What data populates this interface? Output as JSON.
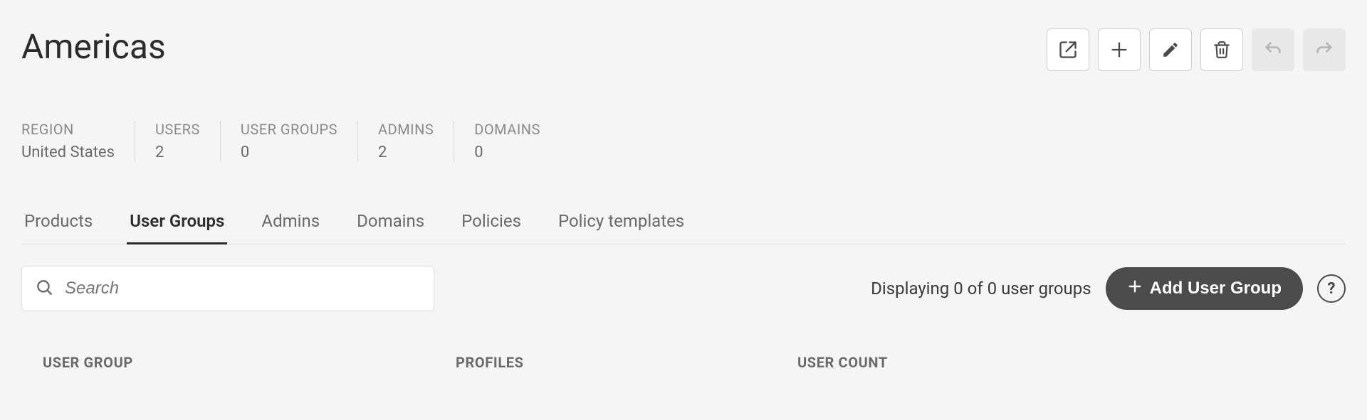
{
  "header": {
    "title": "Americas"
  },
  "toolbar": {
    "export_label": "Export",
    "add_label": "Add",
    "edit_label": "Edit",
    "delete_label": "Delete",
    "undo_label": "Undo",
    "redo_label": "Redo"
  },
  "stats": [
    {
      "label": "REGION",
      "value": "United States"
    },
    {
      "label": "USERS",
      "value": "2"
    },
    {
      "label": "USER GROUPS",
      "value": "0"
    },
    {
      "label": "ADMINS",
      "value": "2"
    },
    {
      "label": "DOMAINS",
      "value": "0"
    }
  ],
  "tabs": [
    {
      "label": "Products",
      "active": false
    },
    {
      "label": "User Groups",
      "active": true
    },
    {
      "label": "Admins",
      "active": false
    },
    {
      "label": "Domains",
      "active": false
    },
    {
      "label": "Policies",
      "active": false
    },
    {
      "label": "Policy templates",
      "active": false
    }
  ],
  "search": {
    "placeholder": "Search",
    "value": ""
  },
  "result_info": {
    "text": "Displaying 0 of 0 user groups"
  },
  "add_group_button": {
    "label": "Add User Group"
  },
  "help_button": {
    "label": "?"
  },
  "table": {
    "columns": [
      {
        "key": "user_group",
        "label": "USER GROUP"
      },
      {
        "key": "profiles",
        "label": "PROFILES"
      },
      {
        "key": "user_count",
        "label": "USER COUNT"
      }
    ],
    "rows": []
  }
}
